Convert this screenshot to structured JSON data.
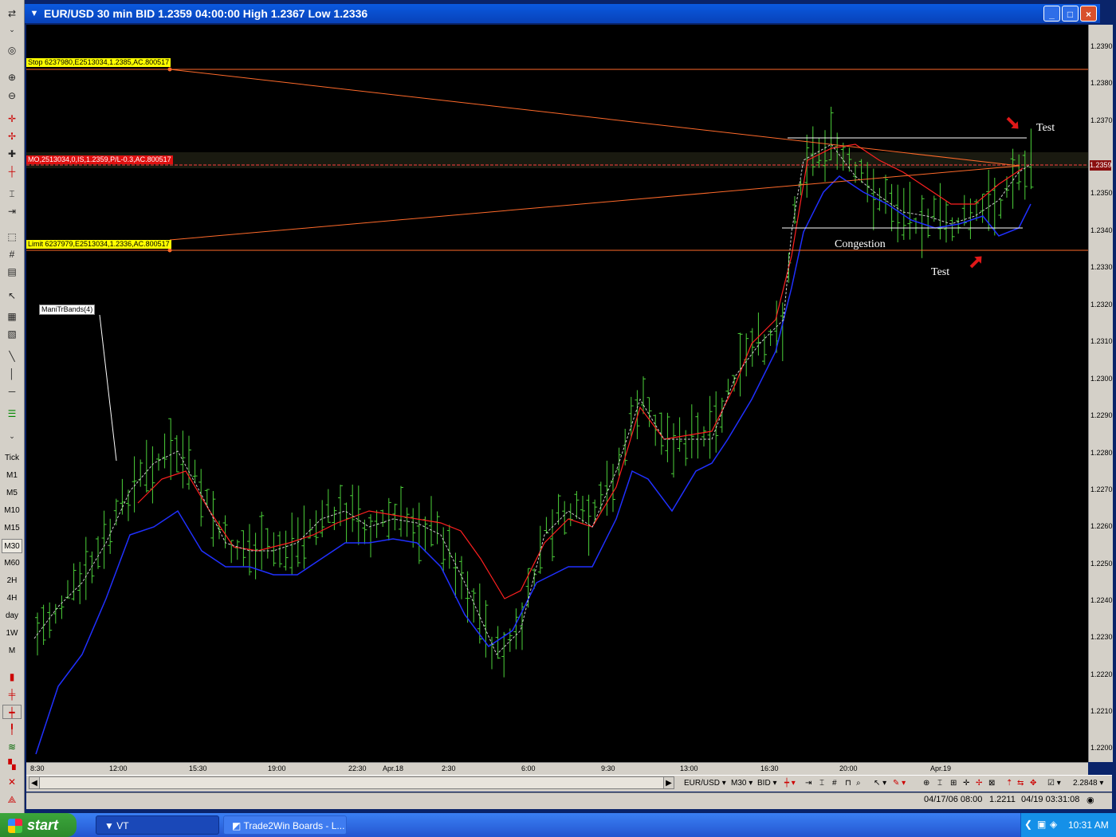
{
  "window": {
    "title": "EUR/USD 30 min BID 1.2359 04:00:00 High 1.2367 Low 1.2336",
    "buttons": [
      "_",
      "□",
      "×"
    ]
  },
  "toolbar": {
    "timeframes": [
      "Tick",
      "M1",
      "M5",
      "M10",
      "M15",
      "M30",
      "M60",
      "2H",
      "4H",
      "day",
      "1W",
      "M"
    ],
    "selected_timeframe": "M30"
  },
  "chart": {
    "order_lines": {
      "stop": "Stop 6237980,E2513034,1.2385,AC.800517",
      "position": "MO,2513034,0,IS,1.2359,P/L-0.3,AC.800517",
      "limit": "Limit 6237979,E2513034,1.2336,AC.800517"
    },
    "indicator_label": "ManiTrBands(4)",
    "annotations": {
      "test_top": "Test",
      "test_bottom": "Test",
      "congestion": "Congestion"
    },
    "current_price": "1.2359",
    "colors": {
      "background": "#000000",
      "bars": "#4cd13a",
      "upper_band": "#ff2020",
      "lower_band": "#2030ff",
      "mid_line": "#cccccc",
      "order_line": "#ff6a2a",
      "tag_yellow": "#ffff00",
      "tag_red": "#e01010"
    }
  },
  "price_axis": [
    "1.2390",
    "1.2380",
    "1.2370",
    "1.2350",
    "1.2340",
    "1.2330",
    "1.2320",
    "1.2310",
    "1.2300",
    "1.2290",
    "1.2280",
    "1.2270",
    "1.2260",
    "1.2250",
    "1.2240",
    "1.2230",
    "1.2220",
    "1.2210",
    "1.2200"
  ],
  "time_axis": [
    "8:30",
    "12:00",
    "15:30",
    "19:00",
    "22:30",
    "Apr.18",
    "2:30",
    "6:00",
    "9:30",
    "13:00",
    "16:30",
    "20:00",
    "Apr.19"
  ],
  "bottom_toolbar": {
    "symbol": "EUR/USD",
    "period": "M30",
    "side": "BID",
    "scale_value": "2.2848"
  },
  "status": {
    "date": "04/17/06 08:00",
    "price": "1.2211",
    "server_time": "04/19 03:31:08"
  },
  "taskbar": {
    "start": "start",
    "tasks": [
      "VT",
      "Trade2Win Boards - L..."
    ],
    "clock": "10:31 AM"
  }
}
